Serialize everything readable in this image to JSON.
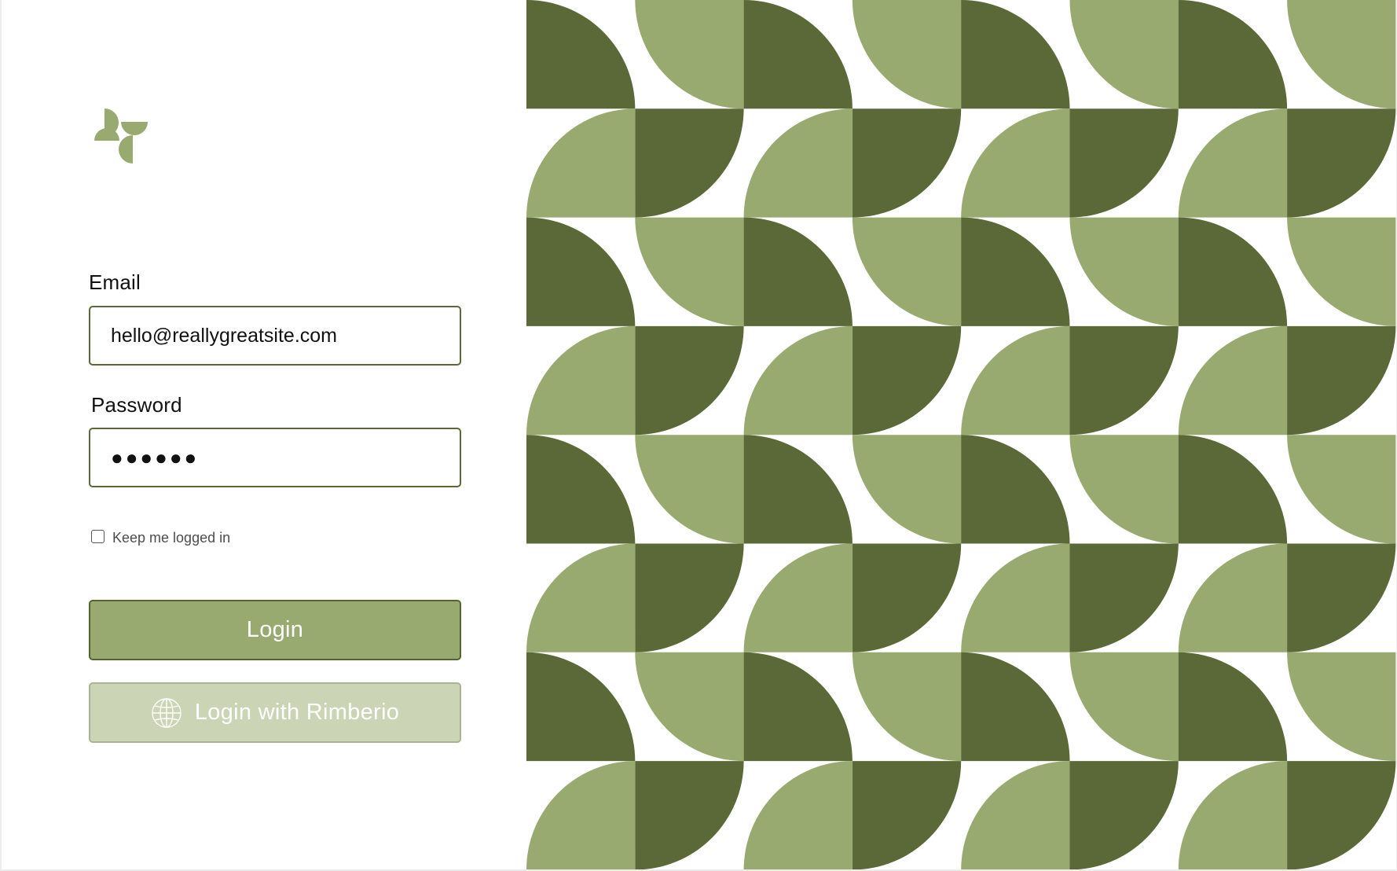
{
  "form": {
    "email_label": "Email",
    "email_value": "hello@reallygreatsite.com",
    "password_label": "Password",
    "password_value": "●●●●●●",
    "keep_logged_in_label": "Keep me logged in",
    "keep_logged_in_checked": false,
    "login_button": "Login",
    "sso_button": "Login with Rimberio"
  },
  "icons": {
    "logo": "pinwheel-logo-icon",
    "sso": "globe-icon"
  },
  "colors": {
    "dark_green": "#5a6937",
    "light_green": "#99aa70",
    "pale_green": "#cbd5b5",
    "background": "#ffffff"
  }
}
